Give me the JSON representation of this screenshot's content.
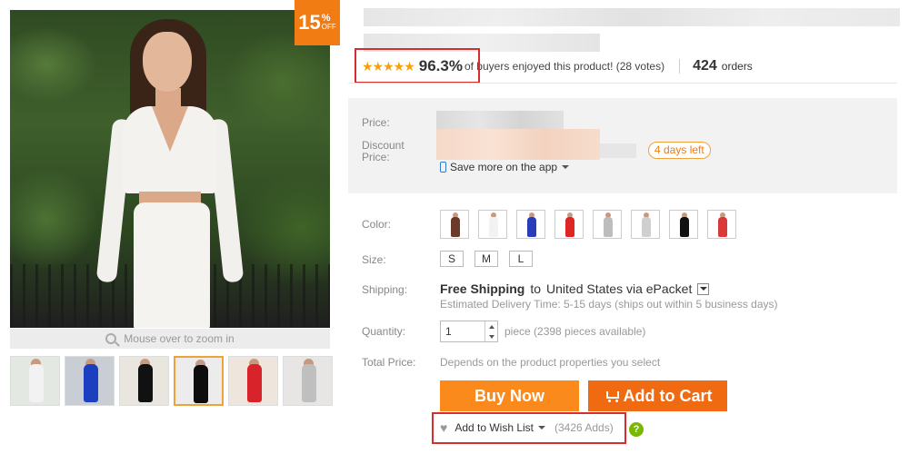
{
  "gallery": {
    "discount_badge": {
      "number": "15",
      "percent": "%",
      "off": "OFF"
    },
    "zoom_hint": "Mouse over to zoom in",
    "thumbnails": [
      {
        "dress_color": "#f2f2f2",
        "bg": "#e4e8e2"
      },
      {
        "dress_color": "#1b3fbf",
        "bg": "#c9cdd4"
      },
      {
        "dress_color": "#111111",
        "bg": "#e9e6e0"
      },
      {
        "dress_color": "#0d0d0d",
        "bg": "#ececec",
        "active": true
      },
      {
        "dress_color": "#d8232a",
        "bg": "#eee5dc"
      },
      {
        "dress_color": "#bfbfbf",
        "bg": "#e8e6e4"
      }
    ]
  },
  "rating": {
    "stars": "★★★★★",
    "percent": "96.3%",
    "text": "of buyers enjoyed this product! (28 votes)",
    "orders_count": "424",
    "orders_label": "orders"
  },
  "price": {
    "price_label": "Price:",
    "discount_label_line1": "Discount",
    "discount_label_line2": "Price:",
    "days_left": "4 days left",
    "app_link": "Save more on the app"
  },
  "color": {
    "label": "Color:",
    "swatches": [
      "#6b3a2a",
      "#f2f2f2",
      "#2a3db8",
      "#e02525",
      "#bdbdbd",
      "#cfcfcf",
      "#111111",
      "#d83a3a"
    ]
  },
  "size": {
    "label": "Size:",
    "options": [
      "S",
      "M",
      "L"
    ]
  },
  "shipping": {
    "label": "Shipping:",
    "free": "Free Shipping",
    "to": "to",
    "destination": "United States via ePacket",
    "estimate": "Estimated Delivery Time: 5-15 days (ships out within 5 business days)"
  },
  "quantity": {
    "label": "Quantity:",
    "value": "1",
    "availability": "piece (2398 pieces available)"
  },
  "total": {
    "label": "Total Price:",
    "text": "Depends on the product properties you select"
  },
  "actions": {
    "buy_now": "Buy Now",
    "add_to_cart": "Add to Cart",
    "wish_list": "Add to Wish List",
    "wish_adds": "(3426 Adds)",
    "help": "?"
  },
  "colors": {
    "accent_orange": "#f97a12",
    "highlight_red": "#d62d2d",
    "star_color": "#f5a10b",
    "help_green": "#7ab800"
  }
}
